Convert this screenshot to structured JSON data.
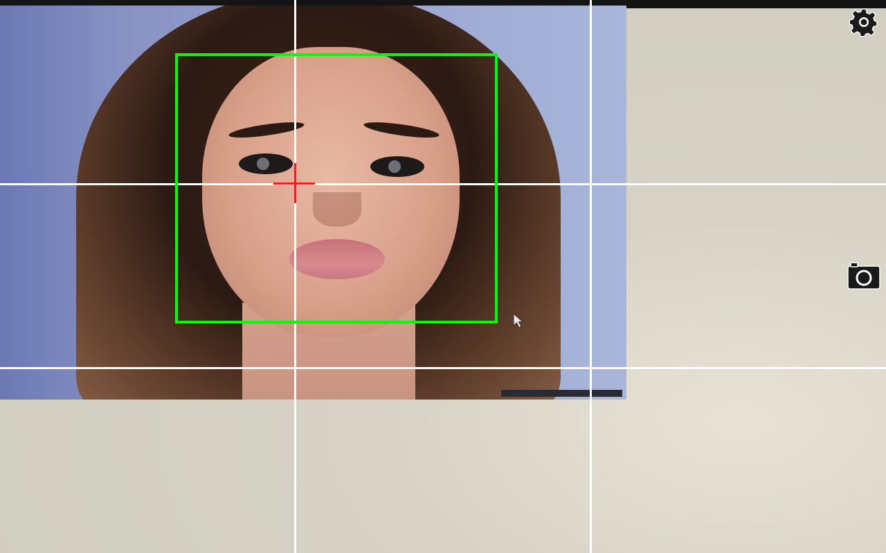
{
  "app": {
    "screen": "camera-viewfinder"
  },
  "overlay": {
    "grid": "rule-of-thirds",
    "grid_color": "#ffffff",
    "face_box_color": "#00ff00",
    "crosshair_color": "#ff1a1a"
  },
  "controls": {
    "settings_icon": "gear-icon",
    "capture_icon": "camera-icon"
  },
  "preview": {
    "subject": "photo-print",
    "watermark_text": ""
  }
}
